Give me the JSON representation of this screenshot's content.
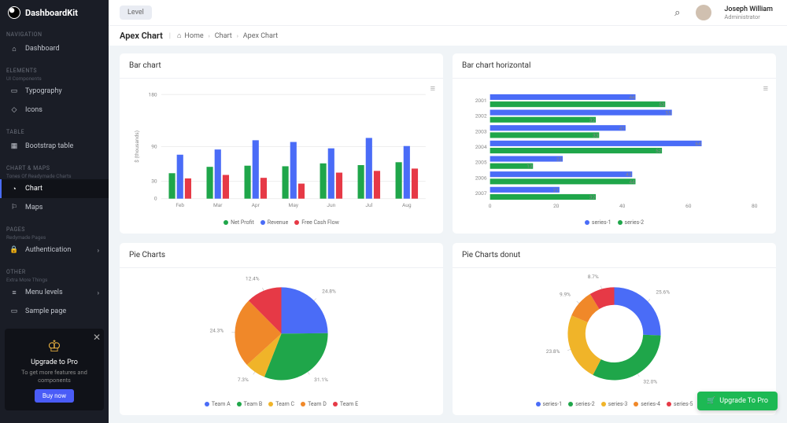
{
  "brand": "DashboardKit",
  "topbar": {
    "level_btn": "Level",
    "user_name": "Joseph William",
    "user_role": "Administrator"
  },
  "breadcrumb": {
    "title": "Apex Chart",
    "home": "Home",
    "mid": "Chart",
    "current": "Apex Chart"
  },
  "nav": {
    "sec_nav": "NAVIGATION",
    "dashboard": "Dashboard",
    "sec_elements": "ELEMENTS",
    "sec_elements_sub": "UI Components",
    "typography": "Typography",
    "icons": "Icons",
    "sec_table": "TABLE",
    "bootstrap_table": "Bootstrap table",
    "sec_chart": "CHART & MAPS",
    "sec_chart_sub": "Tones Of Readymade Charts",
    "chart": "Chart",
    "maps": "Maps",
    "sec_pages": "PAGES",
    "sec_pages_sub": "Redymade Pages",
    "auth": "Authentication",
    "sec_other": "OTHER",
    "sec_other_sub": "Extra More Things",
    "menu_levels": "Menu levels",
    "sample": "Sample page"
  },
  "upgrade": {
    "title": "Upgrade to Pro",
    "desc": "To get more features and components",
    "buy": "Buy now"
  },
  "cards": {
    "bar": "Bar chart",
    "barh": "Bar chart horizontal",
    "pie": "Pie Charts",
    "donut": "Pie Charts donut"
  },
  "float_btn": "Upgrade To Pro",
  "chart_data": [
    {
      "type": "bar",
      "title": "Bar chart",
      "categories": [
        "Feb",
        "Mar",
        "Apr",
        "May",
        "Jun",
        "Jul",
        "Aug"
      ],
      "ylabel": "$ (thousands)",
      "ylim": [
        0,
        180
      ],
      "yticks": [
        0,
        30,
        90,
        180
      ],
      "series": [
        {
          "name": "Net Profit",
          "values": [
            44,
            55,
            57,
            56,
            61,
            58,
            63
          ],
          "color": "#1fa64a"
        },
        {
          "name": "Revenue",
          "values": [
            76,
            85,
            101,
            98,
            87,
            105,
            91
          ],
          "color": "#4a6cf7"
        },
        {
          "name": "Free Cash Flow",
          "values": [
            35,
            41,
            36,
            26,
            45,
            48,
            52
          ],
          "color": "#e63946"
        }
      ],
      "legend": [
        "Net Profit",
        "Revenue",
        "Free Cash Flow"
      ]
    },
    {
      "type": "bar_horizontal",
      "title": "Bar chart horizontal",
      "categories": [
        "2001",
        "2002",
        "2003",
        "2004",
        "2005",
        "2006",
        "2007"
      ],
      "xlim": [
        0,
        80
      ],
      "xticks": [
        0,
        20,
        40,
        60,
        80
      ],
      "series": [
        {
          "name": "series-1",
          "values": [
            44,
            55,
            41,
            64,
            22,
            43,
            21
          ],
          "color": "#4a6cf7"
        },
        {
          "name": "series-2",
          "values": [
            53,
            32,
            33,
            52,
            13,
            44,
            32
          ],
          "color": "#1fa64a"
        }
      ],
      "data_labels": {
        "series-1": [
          44,
          55,
          41,
          64,
          22,
          43,
          21
        ],
        "series-2": [
          53,
          32,
          33,
          52,
          13,
          44,
          32
        ]
      },
      "legend": [
        "series-1",
        "series-2"
      ]
    },
    {
      "type": "pie",
      "title": "Pie Charts",
      "labels": [
        "Team A",
        "Team B",
        "Team C",
        "Team D",
        "Team E"
      ],
      "values": [
        24.8,
        31.1,
        7.3,
        24.3,
        12.4
      ],
      "colors": [
        "#4a6cf7",
        "#1fa64a",
        "#f0b429",
        "#f08829",
        "#e63946"
      ],
      "display_labels": [
        "24.8%",
        "31.1%",
        "7.3%",
        "24.3%",
        "12.4%"
      ]
    },
    {
      "type": "donut",
      "title": "Pie Charts donut",
      "labels": [
        "series-1",
        "series-2",
        "series-3",
        "series-4",
        "series-5"
      ],
      "values": [
        25.6,
        32.0,
        23.8,
        9.9,
        8.7
      ],
      "colors": [
        "#4a6cf7",
        "#1fa64a",
        "#f0b429",
        "#f08829",
        "#e63946"
      ],
      "display_labels": [
        "25.6%",
        "32.0%",
        "23.8%",
        "9.9%",
        "8.7%"
      ]
    }
  ]
}
